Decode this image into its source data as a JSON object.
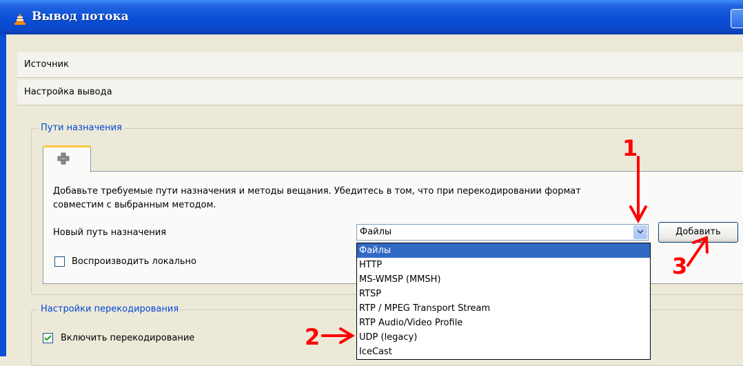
{
  "window": {
    "title": "Вывод потока",
    "icon": "vlc-cone-icon"
  },
  "sections": {
    "source": "Источник",
    "output_setup": "Настройка вывода"
  },
  "destinations": {
    "group_title": "Пути назначения",
    "tab_icon": "plus-icon",
    "description_line1": "Добавьте требуемые пути назначения и методы вещания. Убедитесь в том, что при перекодировании формат",
    "description_line2": "совместим с выбранным методом.",
    "new_destination_label": "Новый путь назначения",
    "combo_value": "Файлы",
    "add_button": "Добавить",
    "play_locally_label": "Воспроизводить локально",
    "play_locally_checked": false,
    "dropdown_options": [
      "Файлы",
      "HTTP",
      "MS-WMSP (MMSH)",
      "RTSP",
      "RTP / MPEG Transport Stream",
      "RTP Audio/Video Profile",
      "UDP (legacy)",
      "IceCast"
    ],
    "dropdown_selected": "Файлы"
  },
  "transcoding": {
    "group_title": "Настройки перекодирования",
    "enable_label": "Включить перекодирование",
    "enable_checked": true
  },
  "annotations": {
    "marker1": "1",
    "marker2": "2",
    "marker3": "3",
    "color": "#ff0000"
  }
}
